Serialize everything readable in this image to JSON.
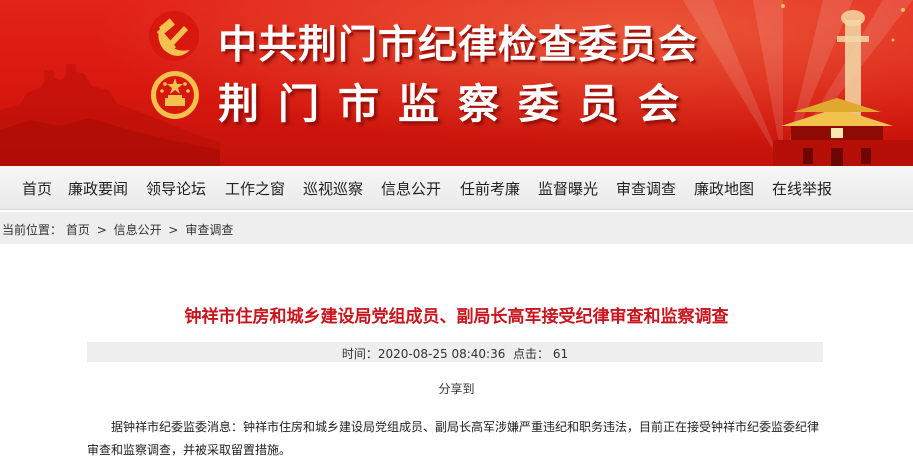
{
  "header": {
    "title": "中共荆门市纪律检查委员会",
    "subtitle": "荆门市监察委员会"
  },
  "nav": {
    "items": [
      "首页",
      "廉政要闻",
      "领导论坛",
      "工作之窗",
      "巡视巡察",
      "信息公开",
      "任前考廉",
      "监督曝光",
      "审查调查",
      "廉政地图",
      "在线举报"
    ]
  },
  "breadcrumb": {
    "prefix": "当前位置：",
    "items": [
      "首页",
      "信息公开",
      "审查调查"
    ],
    "separator": ">"
  },
  "article": {
    "title": "钟祥市住房和城乡建设局党组成员、副局长高军接受纪律审查和监察调查",
    "time_label": "时间：",
    "time_value": "2020-08-25 08:40:36",
    "clicks_label": "点击：",
    "clicks_value": "61",
    "share_label": "分享到",
    "body": "据钟祥市纪委监委消息：钟祥市住房和城乡建设局党组成员、副局长高军涉嫌严重违纪和职务违法，目前正在接受钟祥市纪委监委纪律审查和监察调查，并被采取留置措施。"
  },
  "colors": {
    "banner_red": "#d8180f",
    "title_red": "#c8161e",
    "gold": "#f2c14e"
  }
}
